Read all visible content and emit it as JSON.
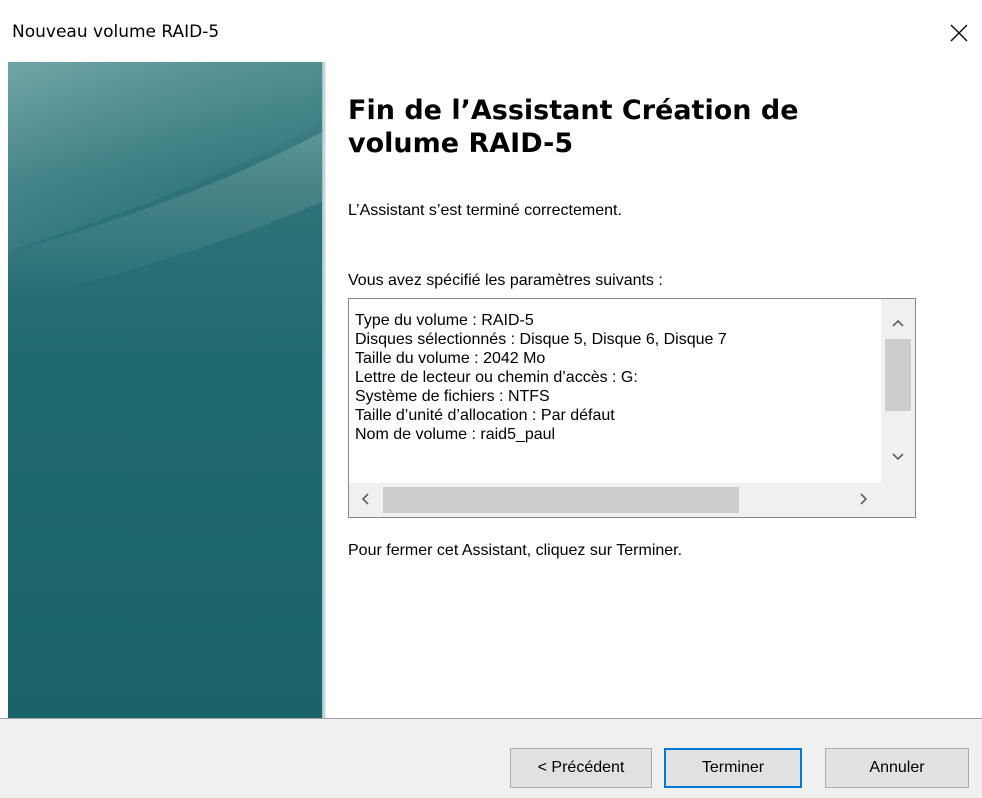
{
  "window": {
    "title": "Nouveau volume RAID-5"
  },
  "icons": {
    "close": "close-icon",
    "scroll_up": "chevron-up-icon",
    "scroll_down": "chevron-down-icon",
    "scroll_left": "chevron-left-icon",
    "scroll_right": "chevron-right-icon"
  },
  "colors": {
    "side_panel": "#1f6a70",
    "focus_border": "#0078d7",
    "footer_bg": "#f0f0f0"
  },
  "main": {
    "heading": "Fin de l’Assistant Création de volume RAID-5",
    "completion_text": "L’Assistant s’est terminé correctement.",
    "settings_intro": "Vous avez spécifié les paramètres suivants :",
    "summary_lines": [
      "Type du volume : RAID-5",
      "Disques sélectionnés : Disque 5, Disque 6, Disque 7",
      "Taille du volume : 2042 Mo",
      "Lettre de lecteur ou chemin d’accès : G:",
      "Système de fichiers : NTFS",
      "Taille d’unité d’allocation : Par défaut",
      "Nom de volume : raid5_paul"
    ],
    "close_instruction": "Pour fermer cet Assistant, cliquez sur Terminer."
  },
  "footer": {
    "back_label": "< Précédent",
    "finish_label": "Terminer",
    "cancel_label": "Annuler"
  }
}
